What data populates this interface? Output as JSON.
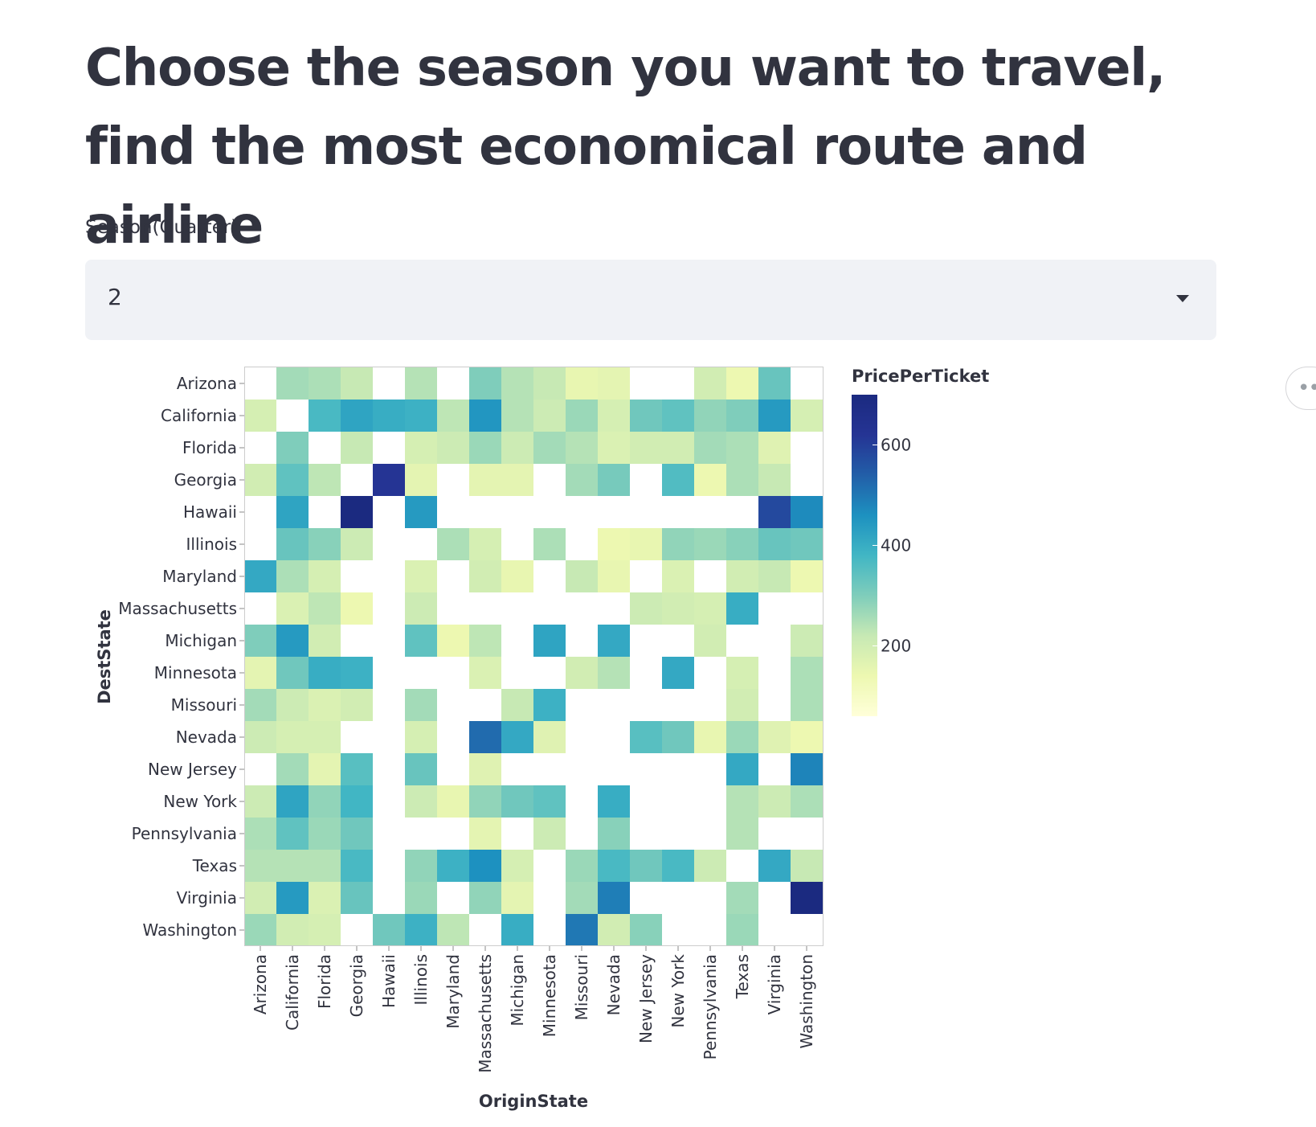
{
  "page": {
    "title": "Choose the season you want to travel, find the most economical route and airline",
    "select_label": "Season(Quarter)",
    "select_value": "2",
    "menu_dots": "•••"
  },
  "chart_data": {
    "type": "heatmap",
    "title": "",
    "xlabel": "OriginState",
    "ylabel": "DestState",
    "x": [
      "Arizona",
      "California",
      "Florida",
      "Georgia",
      "Hawaii",
      "Illinois",
      "Maryland",
      "Massachusetts",
      "Michigan",
      "Minnesota",
      "Missouri",
      "Nevada",
      "New Jersey",
      "New York",
      "Pennsylvania",
      "Texas",
      "Virginia",
      "Washington"
    ],
    "y": [
      "Arizona",
      "California",
      "Florida",
      "Georgia",
      "Hawaii",
      "Illinois",
      "Maryland",
      "Massachusetts",
      "Michigan",
      "Minnesota",
      "Missouri",
      "Nevada",
      "New Jersey",
      "New York",
      "Pennsylvania",
      "Texas",
      "Virginia",
      "Washington"
    ],
    "values": [
      [
        null,
        260,
        250,
        220,
        null,
        240,
        null,
        300,
        240,
        220,
        150,
        160,
        null,
        null,
        200,
        140,
        330,
        null
      ],
      [
        190,
        null,
        370,
        420,
        400,
        390,
        230,
        450,
        240,
        210,
        270,
        190,
        320,
        340,
        280,
        300,
        440,
        190
      ],
      [
        null,
        300,
        null,
        220,
        null,
        190,
        210,
        270,
        210,
        260,
        240,
        180,
        200,
        200,
        260,
        250,
        170,
        null
      ],
      [
        200,
        340,
        230,
        null,
        620,
        160,
        null,
        160,
        160,
        null,
        260,
        310,
        null,
        360,
        140,
        250,
        220,
        null
      ],
      [
        null,
        420,
        null,
        700,
        null,
        440,
        null,
        null,
        null,
        null,
        null,
        null,
        null,
        null,
        null,
        null,
        580,
        470
      ],
      [
        null,
        330,
        290,
        210,
        null,
        null,
        250,
        190,
        null,
        250,
        null,
        140,
        150,
        280,
        270,
        290,
        330,
        320
      ],
      [
        410,
        250,
        190,
        null,
        null,
        180,
        null,
        200,
        150,
        null,
        220,
        150,
        null,
        180,
        null,
        200,
        220,
        140
      ],
      [
        null,
        180,
        230,
        140,
        null,
        210,
        null,
        null,
        null,
        null,
        null,
        null,
        210,
        200,
        190,
        400,
        null,
        null
      ],
      [
        300,
        440,
        200,
        null,
        null,
        340,
        140,
        230,
        null,
        420,
        null,
        410,
        null,
        null,
        200,
        null,
        null,
        210
      ],
      [
        160,
        320,
        400,
        390,
        null,
        null,
        null,
        180,
        null,
        null,
        200,
        240,
        null,
        410,
        null,
        190,
        null,
        250
      ],
      [
        260,
        210,
        180,
        200,
        null,
        260,
        null,
        null,
        220,
        390,
        null,
        null,
        null,
        null,
        null,
        200,
        null,
        250
      ],
      [
        210,
        190,
        190,
        null,
        null,
        190,
        null,
        520,
        410,
        170,
        null,
        null,
        350,
        320,
        150,
        270,
        170,
        140
      ],
      [
        null,
        260,
        160,
        350,
        null,
        330,
        null,
        170,
        null,
        null,
        null,
        null,
        null,
        null,
        null,
        410,
        null,
        480
      ],
      [
        210,
        420,
        280,
        380,
        null,
        210,
        150,
        280,
        320,
        340,
        null,
        400,
        null,
        null,
        null,
        240,
        210,
        250
      ],
      [
        250,
        340,
        270,
        320,
        null,
        null,
        null,
        160,
        null,
        210,
        null,
        290,
        null,
        null,
        null,
        240,
        null,
        null
      ],
      [
        240,
        240,
        240,
        370,
        null,
        280,
        390,
        460,
        190,
        null,
        270,
        370,
        320,
        370,
        210,
        null,
        410,
        220
      ],
      [
        200,
        440,
        180,
        330,
        null,
        270,
        null,
        280,
        160,
        null,
        260,
        490,
        null,
        null,
        null,
        260,
        null,
        700
      ],
      [
        270,
        200,
        190,
        null,
        320,
        390,
        230,
        null,
        400,
        null,
        500,
        200,
        290,
        null,
        null,
        270,
        null,
        null
      ]
    ],
    "legend": {
      "title": "PricePerTicket",
      "position": "right",
      "min": 60,
      "max": 700,
      "ticks": [
        200,
        400,
        600
      ]
    },
    "color_scheme": [
      "#ffffd9",
      "#edf8b1",
      "#c7e9b4",
      "#7fcdbb",
      "#41b6c4",
      "#1d91c0",
      "#225ea8",
      "#253494",
      "#1b2a80"
    ]
  }
}
